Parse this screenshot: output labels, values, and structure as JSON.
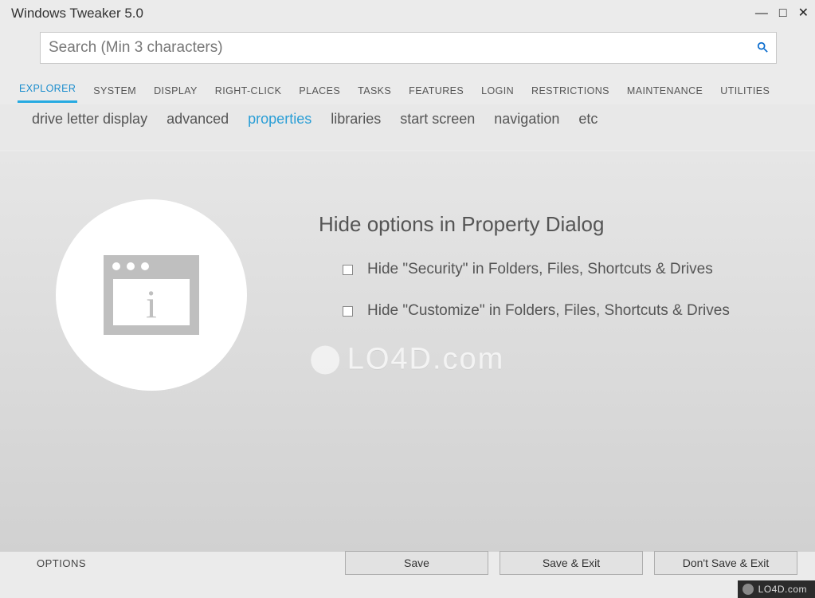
{
  "window": {
    "title": "Windows Tweaker 5.0",
    "controls": {
      "min": "—",
      "max": "□",
      "close": "✕"
    }
  },
  "search": {
    "placeholder": "Search (Min 3 characters)",
    "value": ""
  },
  "tabs": [
    {
      "label": "EXPLORER",
      "active": true
    },
    {
      "label": "SYSTEM"
    },
    {
      "label": "DISPLAY"
    },
    {
      "label": "RIGHT-CLICK"
    },
    {
      "label": "PLACES"
    },
    {
      "label": "TASKS"
    },
    {
      "label": "FEATURES"
    },
    {
      "label": "LOGIN"
    },
    {
      "label": "RESTRICTIONS"
    },
    {
      "label": "MAINTENANCE"
    },
    {
      "label": "UTILITIES"
    }
  ],
  "subtabs": [
    {
      "label": "drive letter display"
    },
    {
      "label": "advanced"
    },
    {
      "label": "properties",
      "active": true
    },
    {
      "label": "libraries"
    },
    {
      "label": "start screen"
    },
    {
      "label": "navigation"
    },
    {
      "label": "etc"
    }
  ],
  "section": {
    "title": "Hide options in Property Dialog",
    "items": [
      {
        "label": "Hide \"Security\" in Folders, Files, Shortcuts & Drives",
        "checked": false
      },
      {
        "label": "Hide \"Customize\" in Folders, Files, Shortcuts & Drives",
        "checked": false
      }
    ]
  },
  "watermark": "LO4D.com",
  "footer": {
    "options_label": "OPTIONS",
    "save": "Save",
    "save_exit": "Save & Exit",
    "dont_save_exit": "Don't Save & Exit"
  },
  "badge": "LO4D.com"
}
